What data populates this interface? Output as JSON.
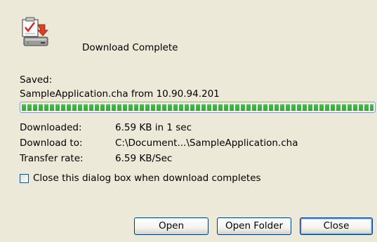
{
  "dialog": {
    "title": "Download Complete",
    "icon": "download-complete-icon"
  },
  "saved": {
    "label": "Saved:",
    "source": "SampleApplication.cha from 10.90.94.201"
  },
  "progress": {
    "percent": 100,
    "color": "#3cb43c"
  },
  "info": {
    "downloaded_label": "Downloaded:",
    "downloaded_value": "6.59 KB in 1 sec",
    "download_to_label": "Download to:",
    "download_to_value": "C:\\Document...\\SampleApplication.cha",
    "rate_label": "Transfer rate:",
    "rate_value": "6.59 KB/Sec"
  },
  "options": {
    "close_when_done_label": "Close this dialog box when download completes",
    "close_when_done_checked": false
  },
  "buttons": {
    "open": "Open",
    "open_folder": "Open Folder",
    "close": "Close"
  }
}
